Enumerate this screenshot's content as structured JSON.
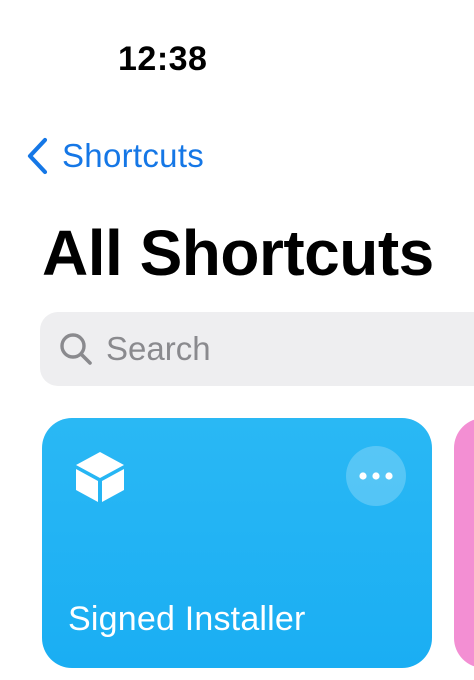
{
  "status_bar": {
    "time": "12:38"
  },
  "nav": {
    "back_label": "Shortcuts",
    "back_icon": "chevron-left-icon"
  },
  "page": {
    "title": "All Shortcuts"
  },
  "search": {
    "placeholder": "Search",
    "value": "",
    "icon": "search-icon"
  },
  "shortcuts": [
    {
      "title": "Signed Installer",
      "icon": "cube-icon",
      "color": "#1fb1f3"
    },
    {
      "title": "",
      "color": "#f38fd3"
    }
  ],
  "colors": {
    "accent": "#1577e6",
    "search_bg": "#eeeef0",
    "placeholder": "#8a8a8e"
  }
}
